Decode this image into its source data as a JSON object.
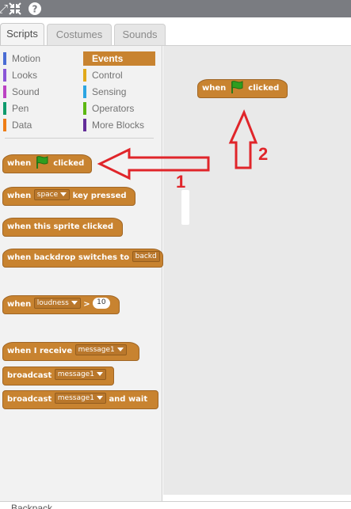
{
  "topbar": {
    "icons": [
      "fullscreen-icon",
      "shrink-icon",
      "help-icon"
    ]
  },
  "tabs": [
    {
      "label": "Scripts",
      "active": true
    },
    {
      "label": "Costumes",
      "active": false
    },
    {
      "label": "Sounds",
      "active": false
    }
  ],
  "categories": {
    "left": [
      {
        "label": "Motion",
        "color": "#4a6cd4"
      },
      {
        "label": "Looks",
        "color": "#8a55d7"
      },
      {
        "label": "Sound",
        "color": "#bb42c3"
      },
      {
        "label": "Pen",
        "color": "#0e9a6c"
      },
      {
        "label": "Data",
        "color": "#ee7d16"
      }
    ],
    "right": [
      {
        "label": "Events",
        "color": "#c88330",
        "active": true
      },
      {
        "label": "Control",
        "color": "#e1a91a"
      },
      {
        "label": "Sensing",
        "color": "#2ca5e2"
      },
      {
        "label": "Operators",
        "color": "#5cb712"
      },
      {
        "label": "More Blocks",
        "color": "#632d99"
      }
    ]
  },
  "blocks": {
    "flag_clicked": {
      "when": "when",
      "clicked": "clicked"
    },
    "key_pressed": {
      "when": "when",
      "key": "space",
      "rest": "key pressed"
    },
    "sprite_clicked": {
      "text": "when this sprite clicked"
    },
    "backdrop_switches": {
      "text": "when backdrop switches to",
      "value": "backd"
    },
    "loudness": {
      "when": "when",
      "sensor": "loudness",
      "op": ">",
      "value": "10"
    },
    "receive": {
      "text": "when I receive",
      "message": "message1"
    },
    "broadcast": {
      "text": "broadcast",
      "message": "message1"
    },
    "broadcast_wait": {
      "text": "broadcast",
      "message": "message1",
      "rest": "and wait"
    }
  },
  "script_area": {
    "flag_block": {
      "when": "when",
      "clicked": "clicked"
    }
  },
  "bottombar": {
    "label": "Backpack"
  },
  "annotations": {
    "label1": "1",
    "label2": "2",
    "color": "#e0252a"
  },
  "colors": {
    "events": "#c88330",
    "flag_green": "#2f9e1f"
  }
}
